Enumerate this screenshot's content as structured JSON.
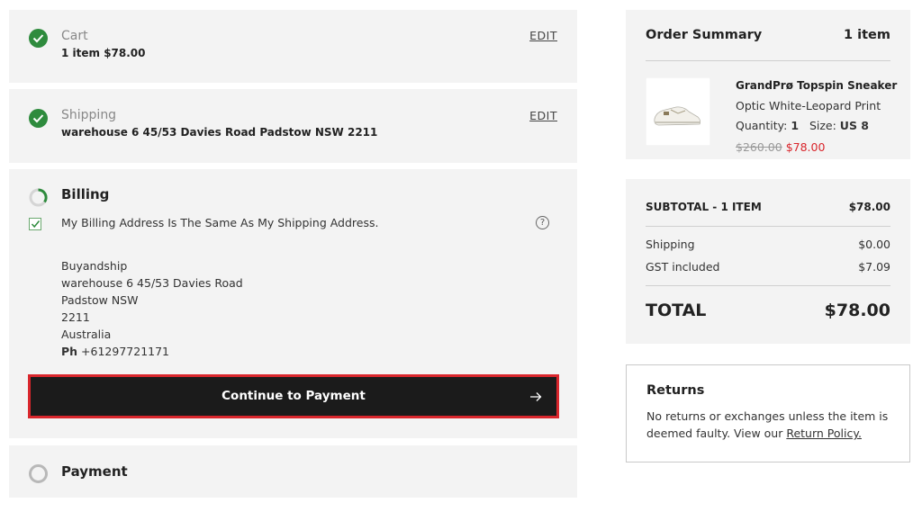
{
  "steps": {
    "cart": {
      "title": "Cart",
      "summary": "1 item $78.00",
      "edit": "EDIT"
    },
    "shipping": {
      "title": "Shipping",
      "summary": "warehouse 6 45/53 Davies Road Padstow NSW 2211",
      "edit": "EDIT"
    },
    "billing": {
      "title": "Billing",
      "same_address_label": "My Billing Address Is The Same As My Shipping Address.",
      "same_address_checked": true,
      "help_icon": "question-circle-icon",
      "address": {
        "name": "Buyandship",
        "line1": "warehouse 6 45/53 Davies Road",
        "line2": "Padstow NSW",
        "postcode": "2211",
        "country": "Australia",
        "phone_label": "Ph",
        "phone": "+61297721171"
      },
      "continue_label": "Continue to Payment"
    },
    "payment": {
      "title": "Payment"
    }
  },
  "order_summary": {
    "title": "Order Summary",
    "count": "1 item",
    "product": {
      "name": "GrandPrø Topspin Sneaker",
      "color": "Optic White-Leopard Print",
      "quantity_label": "Quantity:",
      "quantity": "1",
      "size_label": "Size:",
      "size": "US 8",
      "original_price": "$260.00",
      "sale_price": "$78.00"
    }
  },
  "totals": {
    "subtotal_label": "SUBTOTAL - 1 ITEM",
    "subtotal": "$78.00",
    "shipping_label": "Shipping",
    "shipping": "$0.00",
    "gst_label": "GST included",
    "gst": "$7.09",
    "total_label": "TOTAL",
    "total": "$78.00"
  },
  "returns": {
    "title": "Returns",
    "text": "No returns or exchanges unless the item is deemed faulty. View our ",
    "link": "Return Policy."
  },
  "colors": {
    "success": "#2e8b3d",
    "accent_red": "#d9262c",
    "cta_bg": "#1b1b1b",
    "panel_bg": "#f3f3f3"
  }
}
